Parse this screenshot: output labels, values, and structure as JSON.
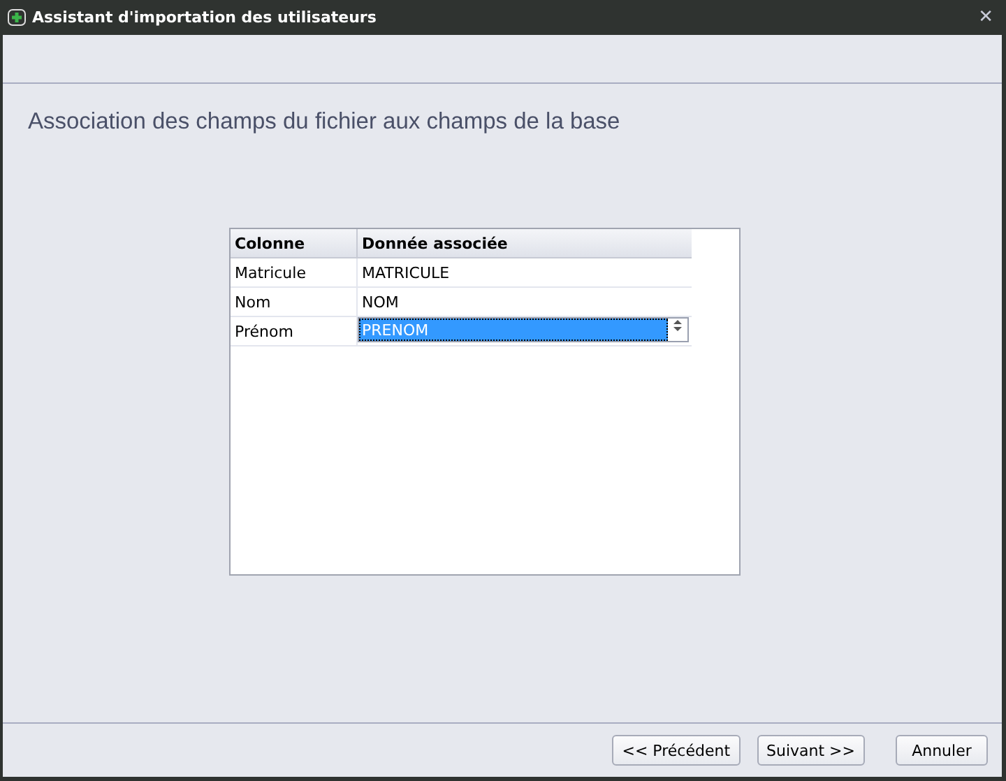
{
  "window": {
    "title": "Assistant d'importation des utilisateurs",
    "close": "✕"
  },
  "heading": "Association des champs du fichier aux champs de la base",
  "table": {
    "columns": [
      "Colonne",
      "Donnée associée"
    ],
    "rows": [
      {
        "column": "Matricule",
        "value": "MATRICULE",
        "editing": false
      },
      {
        "column": "Nom",
        "value": "NOM",
        "editing": false
      },
      {
        "column": "Prénom",
        "value": "PRENOM",
        "editing": true
      }
    ]
  },
  "buttons": [
    "<< Précédent",
    "Suivant >>",
    "Annuler"
  ]
}
